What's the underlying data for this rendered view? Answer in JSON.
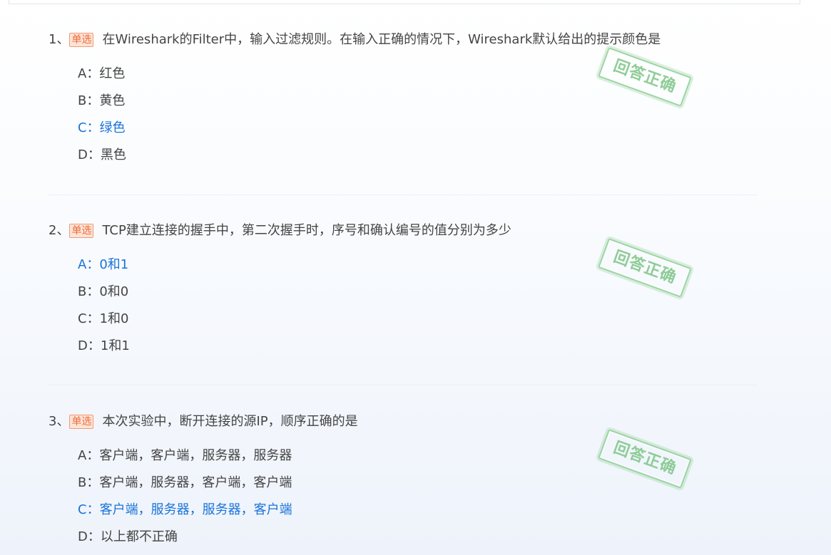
{
  "questions": [
    {
      "number": "1、",
      "tag": "单选",
      "text": "在Wireshark的Filter中，输入过滤规则。在输入正确的情况下，Wireshark默认给出的提示颜色是",
      "options": [
        {
          "label": "A：",
          "text": "红色",
          "selected": false
        },
        {
          "label": "B：",
          "text": "黄色",
          "selected": false
        },
        {
          "label": "C：",
          "text": "绿色",
          "selected": true
        },
        {
          "label": "D：",
          "text": "黑色",
          "selected": false
        }
      ],
      "stamp": "回答正确"
    },
    {
      "number": "2、",
      "tag": "单选",
      "text": "TCP建立连接的握手中，第二次握手时，序号和确认编号的值分别为多少",
      "options": [
        {
          "label": "A：",
          "text": "0和1",
          "selected": true
        },
        {
          "label": "B：",
          "text": "0和0",
          "selected": false
        },
        {
          "label": "C：",
          "text": "1和0",
          "selected": false
        },
        {
          "label": "D：",
          "text": "1和1",
          "selected": false
        }
      ],
      "stamp": "回答正确"
    },
    {
      "number": "3、",
      "tag": "单选",
      "text": "本次实验中，断开连接的源IP，顺序正确的是",
      "options": [
        {
          "label": "A：",
          "text": "客户端，客户端，服务器，服务器",
          "selected": false
        },
        {
          "label": "B：",
          "text": "客户端，服务器，客户端，客户端",
          "selected": false
        },
        {
          "label": "C：",
          "text": "客户端，服务器，服务器，客户端",
          "selected": true
        },
        {
          "label": "D：",
          "text": "以上都不正确",
          "selected": false
        }
      ],
      "stamp": "回答正确"
    }
  ],
  "colors": {
    "selected_option": "#1a73d9",
    "tag_text": "#ee6b3b",
    "tag_bg": "#fde4d6",
    "stamp_green": "#7cc585"
  }
}
